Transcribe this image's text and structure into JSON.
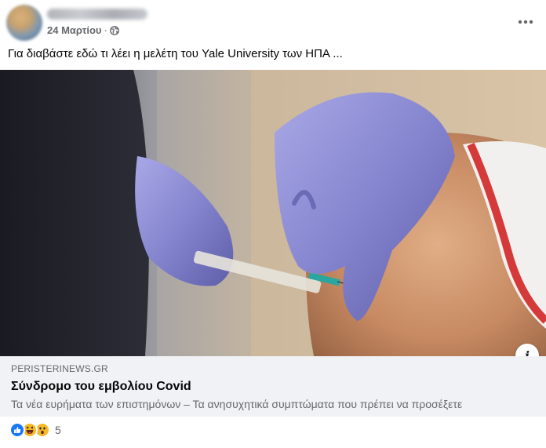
{
  "post": {
    "date": "24 Μαρτίου",
    "separator": "·",
    "caption": "Για διαβάστε εδώ τι λέει η μελέτη του Yale University των ΗΠΑ ..."
  },
  "link": {
    "domain": "PERISTERINEWS.GR",
    "title": "Σύνδρομο του εμβολίου Covid",
    "description": "Τα νέα ευρήματα των επιστημόνων – Τα ανησυχητικά συμπτώματα που πρέπει να προσέξετε",
    "info_glyph": "i"
  },
  "reactions": {
    "icons": [
      "like-icon",
      "haha-icon",
      "wow-icon"
    ],
    "count": "5"
  },
  "colors": {
    "text": "#050505",
    "secondary_text": "#65676b",
    "preview_background": "#f0f2f5",
    "like_blue": "#1877f2",
    "reaction_yellow": "#f7b928"
  }
}
